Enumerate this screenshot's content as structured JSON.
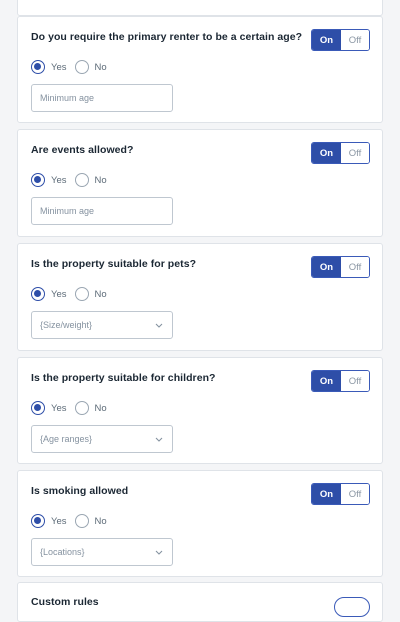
{
  "toggle": {
    "on_label": "On",
    "off_label": "Off"
  },
  "radio": {
    "yes_label": "Yes",
    "no_label": "No"
  },
  "cards": [
    {
      "question": "Do you require the primary renter to be a certain age?",
      "field_placeholder": "Minimum age"
    },
    {
      "question": "Are events allowed?",
      "field_placeholder": "Minimum age"
    },
    {
      "question": "Is the property suitable for pets?",
      "field_placeholder": "{Size/weight}"
    },
    {
      "question": "Is the property suitable for children?",
      "field_placeholder": "{Age ranges}"
    },
    {
      "question": "Is smoking allowed",
      "field_placeholder": "{Locations}"
    },
    {
      "question": "Custom rules"
    }
  ]
}
